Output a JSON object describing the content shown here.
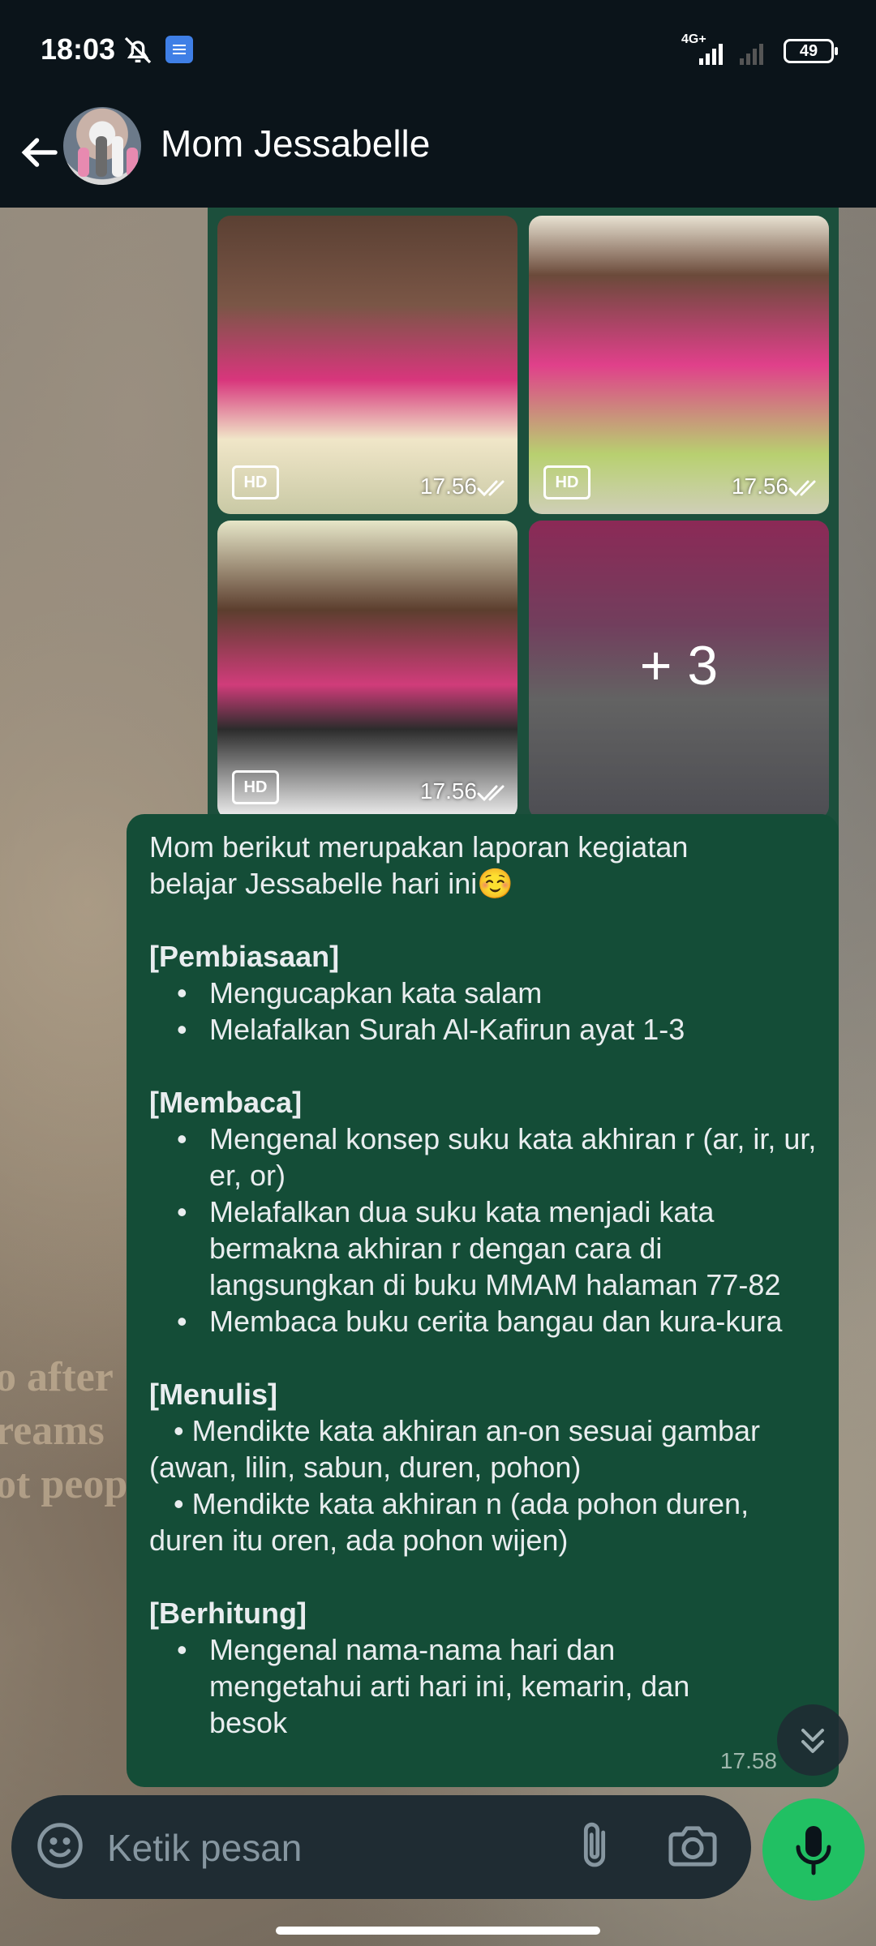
{
  "status_bar": {
    "time": "18:03",
    "network": "4G+",
    "battery": "49",
    "icons": [
      "mute-bell-icon",
      "message-app-icon",
      "signal-icon",
      "signal-weak-icon",
      "battery-icon"
    ]
  },
  "header": {
    "contact_name": "Mom Jessabelle",
    "icons": [
      "back-arrow-icon",
      "video-call-icon",
      "phone-icon",
      "more-vertical-icon"
    ]
  },
  "media_grid": {
    "tiles": [
      {
        "badge": "HD",
        "time": "17.56"
      },
      {
        "badge": "HD",
        "time": "17.56"
      },
      {
        "badge": "HD",
        "time": "17.56"
      },
      {
        "overlay": "+ 3"
      }
    ]
  },
  "message": {
    "intro_1": "Mom berikut merupakan laporan kegiatan",
    "intro_2": "belajar Jessabelle hari ini☺️",
    "sections": {
      "pembiasaan": {
        "title": "[Pembiasaan]",
        "items": [
          "Mengucapkan kata salam",
          "Melafalkan Surah Al-Kafirun ayat 1-3"
        ]
      },
      "membaca": {
        "title": "[Membaca]",
        "items": [
          "Mengenal konsep suku kata akhiran r (ar, ir, ur, er, or)",
          "Melafalkan dua suku kata menjadi kata bermakna akhiran r dengan cara di langsungkan di  buku MMAM halaman 77-82",
          "Membaca buku cerita bangau dan kura-kura"
        ]
      },
      "menulis": {
        "title": "[Menulis]",
        "items": [
          "   • Mendikte kata akhiran an-on sesuai gambar (awan, lilin, sabun, duren, pohon)",
          "   • Mendikte kata akhiran n (ada pohon duren, duren itu oren, ada pohon wijen)"
        ]
      },
      "berhitung": {
        "title": "[Berhitung]",
        "items": [
          "Mengenal nama-nama hari dan mengetahui arti hari ini, kemarin, dan besok"
        ]
      }
    },
    "time": "17.58"
  },
  "composer": {
    "placeholder": "Ketik pesan",
    "icons": [
      "emoji-icon",
      "attach-icon",
      "camera-icon",
      "mic-icon"
    ]
  },
  "wallpaper_text": [
    "o after",
    "reams",
    "ot peopl"
  ],
  "colors": {
    "app_bg": "#0b141a",
    "bubble_out": "#144d37",
    "accent_green": "#21c063",
    "composer_bg": "#1f2c33"
  }
}
